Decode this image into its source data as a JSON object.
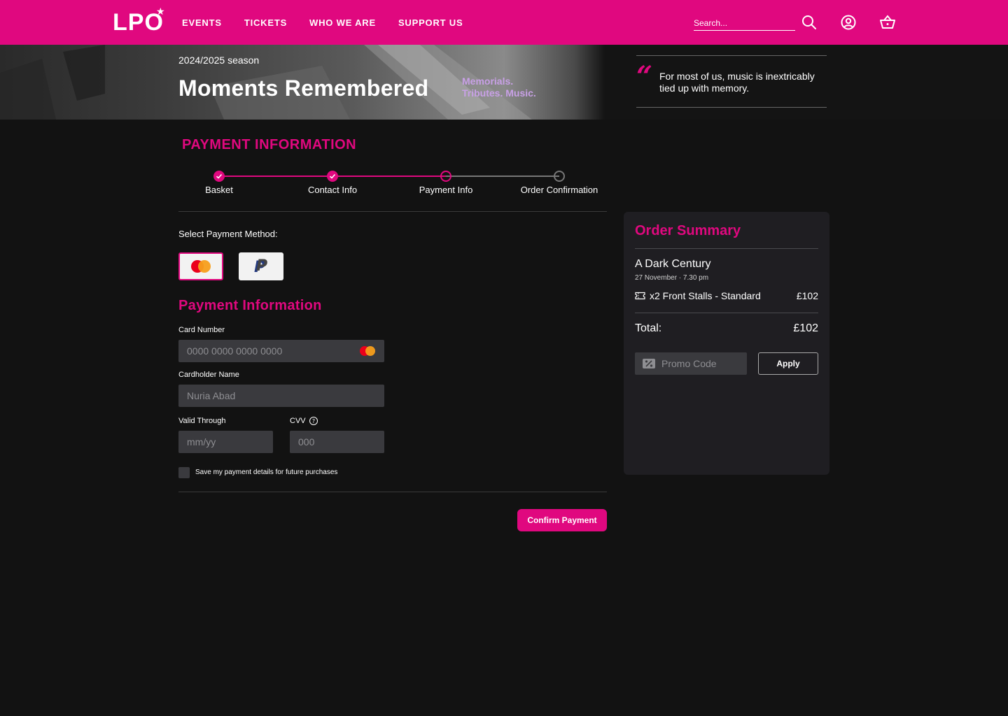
{
  "header": {
    "logo": "LPO",
    "nav": [
      "EVENTS",
      "TICKETS",
      "WHO WE ARE",
      "SUPPORT US"
    ],
    "search_placeholder": "Search...",
    "icons": [
      "search-icon",
      "account-icon",
      "basket-icon"
    ]
  },
  "hero": {
    "season": "2024/2025 season",
    "title": "Moments Remembered",
    "subtitle_line1": "Memorials.",
    "subtitle_line2": "Tributes. Music.",
    "quote": "For most of us, music is inextricably tied up with memory."
  },
  "payment": {
    "heading": "PAYMENT INFORMATION",
    "steps": [
      {
        "label": "Basket",
        "state": "done"
      },
      {
        "label": "Contact Info",
        "state": "done"
      },
      {
        "label": "Payment Info",
        "state": "current"
      },
      {
        "label": "Order Confirmation",
        "state": "todo"
      }
    ],
    "select_method_label": "Select Payment Method:",
    "methods": [
      "mastercard",
      "paypal"
    ],
    "sub_heading": "Payment Information",
    "card_number_label": "Card Number",
    "card_number_placeholder": "0000 0000 0000 0000",
    "cardholder_label": "Cardholder Name",
    "cardholder_placeholder": "Nuria Abad",
    "valid_label": "Valid Through",
    "valid_placeholder": "mm/yy",
    "cvv_label": "CVV",
    "cvv_placeholder": "000",
    "save_label": "Save my payment details for future purchases",
    "confirm_label": "Confirm Payment"
  },
  "summary": {
    "title": "Order Summary",
    "event_name": "A Dark Century",
    "event_date": "27 November · 7.30 pm",
    "ticket_desc": "x2 Front Stalls - Standard",
    "ticket_price": "£102",
    "total_label": "Total:",
    "total_value": "£102",
    "promo_placeholder": "Promo Code",
    "apply_label": "Apply"
  },
  "colors": {
    "brand": "#e0087f",
    "accent_purple": "#c8a0e6",
    "background": "#121212",
    "panel": "#1f1e22"
  }
}
